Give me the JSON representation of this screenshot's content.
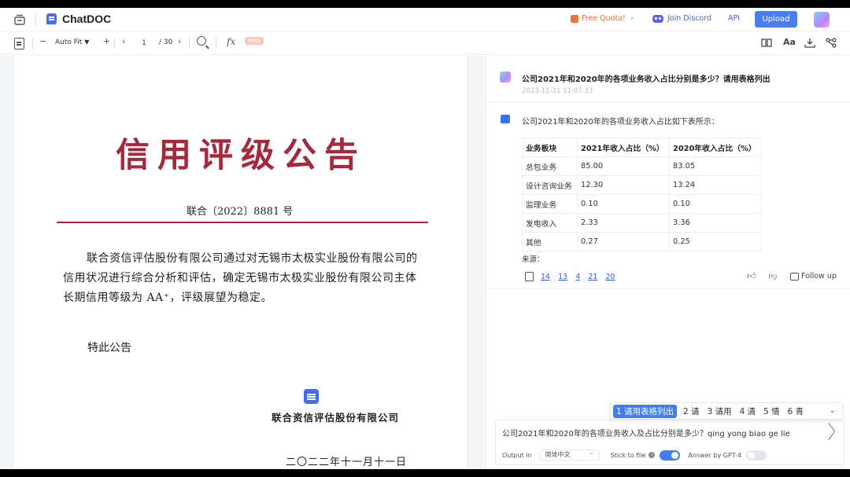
{
  "app": {
    "name": "ChatDOC",
    "quota_label": "Free Quota!",
    "discord_label": "Join Discord",
    "api_label": "API",
    "upload_label": "Upload"
  },
  "pdf_toolbar": {
    "zoom_minus": "−",
    "zoom_mode": "Auto Fit",
    "zoom_plus": "+",
    "prev": "‹",
    "page_current": "1",
    "page_total": "/ 30",
    "next": "›",
    "fx": "fx",
    "beta": "Beta",
    "font_icon_text": "Aa"
  },
  "document": {
    "title": "信用评级公告",
    "number": "联合〔2022〕8881 号",
    "body": "联合资信评估股份有限公司通过对无锡市太极实业股份有限公司的信用状况进行综合分析和评估，确定无锡市太极实业股份有限公司主体长期信用等级为 AA⁺，评级展望为稳定。",
    "notice": "特此公告",
    "org": "联合资信评估股份有限公司",
    "date": "二〇二二年十一月十一日"
  },
  "chat": {
    "question": "公司2021年和2020年的各项业务收入占比分别是多少？请用表格列出",
    "question_time": "2023-11-21 11:07:33",
    "answer_intro": "公司2021年和2020年的各项业务收入占比如下表所示：",
    "table": {
      "headers": [
        "业务板块",
        "2021年收入占比（%）",
        "2020年收入占比（%）"
      ],
      "rows": [
        [
          "总包业务",
          "85.00",
          "83.05"
        ],
        [
          "设计咨询业务",
          "12.30",
          "13.24"
        ],
        [
          "监理业务",
          "0.10",
          "0.10"
        ],
        [
          "发电收入",
          "2.33",
          "3.36"
        ],
        [
          "其他",
          "0.27",
          "0.25"
        ]
      ]
    },
    "source_label": "来源：",
    "refs": [
      "14",
      "13",
      "4",
      "21",
      "20"
    ],
    "follow_up_label": "Follow up"
  },
  "ime": {
    "candidates": [
      "1 请用表格列出",
      "2 请",
      "3 请用",
      "4 清",
      "5 情",
      "6 青"
    ]
  },
  "input": {
    "text": "公司2021年和2020年的各项业务收入及占比分别是多少？qing yong biao ge lie",
    "output_in_label": "Output in",
    "output_in_value": "简体中文",
    "stick_label": "Stick to file",
    "stick_on": true,
    "gpt4_label": "Answer by GPT-4",
    "gpt4_on": false
  },
  "colors": {
    "accent": "#3e6ff0",
    "doc_red": "#a6283b",
    "link": "#3c5fd8"
  }
}
